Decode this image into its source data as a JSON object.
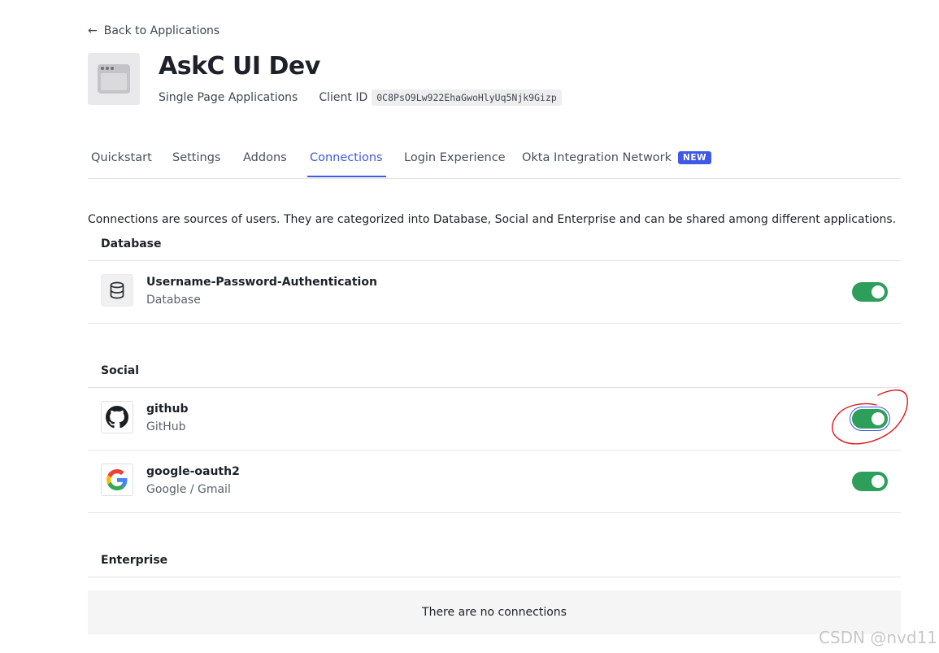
{
  "nav": {
    "back_label": "Back to Applications"
  },
  "app": {
    "name": "AskC UI Dev",
    "type": "Single Page Applications",
    "client_id_label": "Client ID",
    "client_id": "0C8PsO9Lw922EhaGwoHlyUq5Njk9Gizp"
  },
  "tabs": [
    {
      "label": "Quickstart",
      "active": false
    },
    {
      "label": "Settings",
      "active": false
    },
    {
      "label": "Addons",
      "active": false
    },
    {
      "label": "Connections",
      "active": true
    },
    {
      "label": "Login Experience",
      "active": false
    },
    {
      "label": "Okta Integration Network",
      "active": false,
      "badge": "NEW"
    }
  ],
  "description": "Connections are sources of users. They are categorized into Database, Social and Enterprise and can be shared among different applications.",
  "sections": {
    "database": {
      "title": "Database",
      "connections": [
        {
          "name": "Username-Password-Authentication",
          "kind": "Database",
          "icon": "database-icon",
          "enabled": true
        }
      ]
    },
    "social": {
      "title": "Social",
      "connections": [
        {
          "name": "github",
          "kind": "GitHub",
          "icon": "github-icon",
          "enabled": true,
          "focused": true
        },
        {
          "name": "google-oauth2",
          "kind": "Google / Gmail",
          "icon": "google-icon",
          "enabled": true
        }
      ]
    },
    "enterprise": {
      "title": "Enterprise",
      "empty_text": "There are no connections"
    }
  },
  "colors": {
    "accent": "#3f59e4",
    "toggle_on": "#2e9e5b",
    "annotation": "#e0161c"
  },
  "watermark": "CSDN @nvd11"
}
